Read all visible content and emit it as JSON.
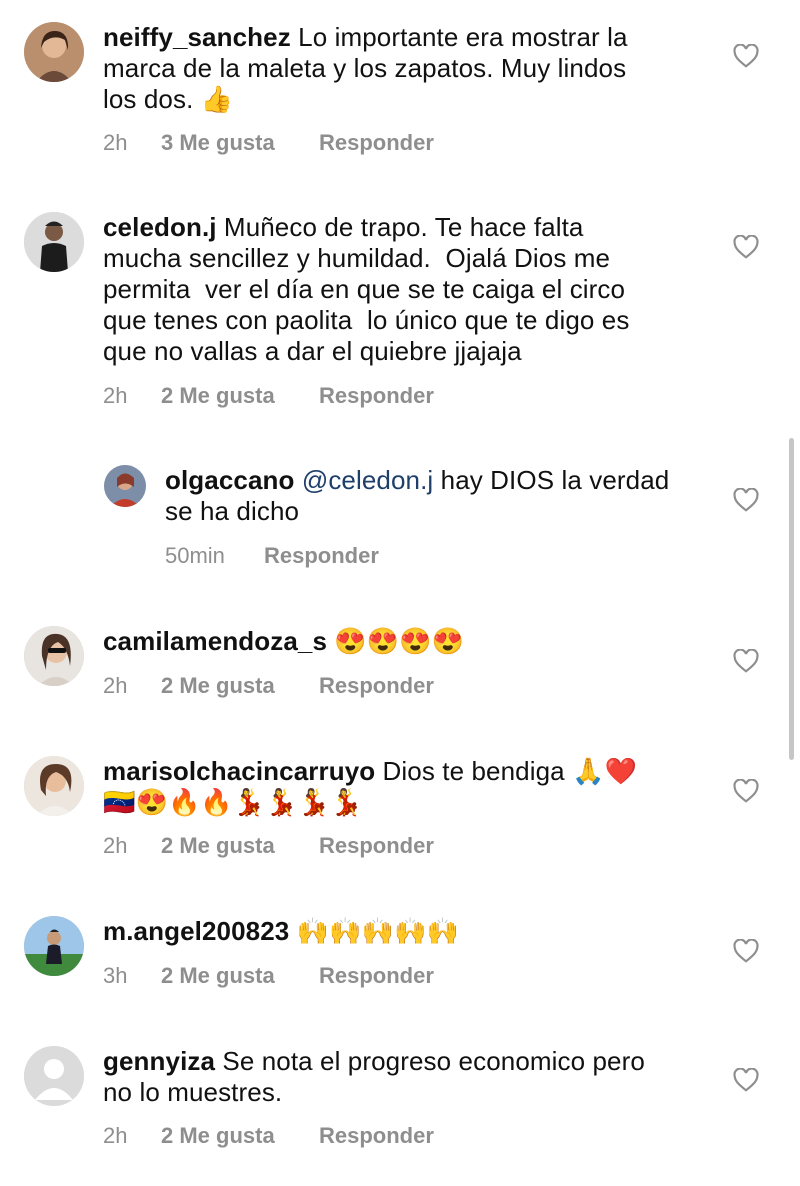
{
  "comments": [
    {
      "username": "neiffy_sanchez",
      "text": " Lo importante era mostrar la\nmarca de la maleta y los zapatos. Muy lindos\nlos dos. 👍",
      "time": "2h",
      "likes": "3 Me gusta",
      "reply": "Responder"
    },
    {
      "username": "celedon.j",
      "text": " Muñeco de trapo. Te hace falta\nmucha sencillez y humildad.  Ojalá Dios me\npermita  ver el día en que se te caiga el circo\nque tenes con paolita  lo único que te digo es\nque no vallas a dar el quiebre jjajaja",
      "time": "2h",
      "likes": "2 Me gusta",
      "reply": "Responder"
    },
    {
      "username": "olgaccano",
      "mention": "@celedon.j",
      "text": " hay DIOS la verdad\nse ha dicho",
      "time": "50min",
      "reply": "Responder"
    },
    {
      "username": "camilamendoza_s",
      "text": " 😍😍😍😍",
      "time": "2h",
      "likes": "2 Me gusta",
      "reply": "Responder"
    },
    {
      "username": "marisolchacincarruyo",
      "text": " Dios te bendiga 🙏❤️\n🇻🇪😍🔥🔥💃💃💃💃",
      "time": "2h",
      "likes": "2 Me gusta",
      "reply": "Responder"
    },
    {
      "username": "m.angel200823",
      "text": " 🙌🙌🙌🙌🙌",
      "time": "3h",
      "likes": "2 Me gusta",
      "reply": "Responder"
    },
    {
      "username": "gennyiza",
      "text": " Se nota el progreso economico pero\nno lo muestres.",
      "time": "2h",
      "likes": "2 Me gusta",
      "reply": "Responder"
    }
  ],
  "icons": {
    "like": "heart-outline-icon",
    "default_avatar": "default-avatar-icon"
  },
  "colors": {
    "meta_text": "#8e8e8e",
    "mention": "#1f3f6b",
    "icon": "#8e8e8e"
  }
}
